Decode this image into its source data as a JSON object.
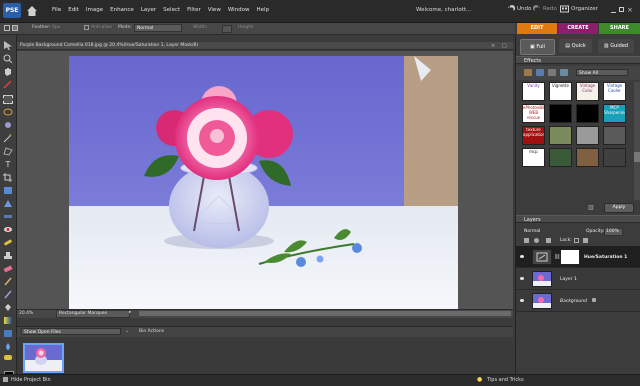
{
  "app": {
    "logo": "PSE"
  },
  "menu": [
    "File",
    "Edit",
    "Image",
    "Enhance",
    "Layer",
    "Select",
    "Filter",
    "View",
    "Window",
    "Help"
  ],
  "topbar": {
    "welcome": "Welcome, charlott...",
    "undo": "Undo",
    "redo": "Redo",
    "organizer": "Organizer"
  },
  "options": {
    "feather_label": "Feather:",
    "feather_value": "0px",
    "antialias": "Anti-alias",
    "mode_label": "Mode:",
    "mode_value": "Normal",
    "width_label": "Width:",
    "height_label": "Height:"
  },
  "tabs": {
    "edit": "EDIT",
    "create": "CREATE",
    "share": "SHARE"
  },
  "subtabs": {
    "full": "Full",
    "quick": "Quick",
    "guided": "Guided"
  },
  "document": {
    "title": "Purple Background Camellia 018.jpg @ 20.4%(Hue/Saturation 1, Layer Mask/8)",
    "zoom": "20.4%",
    "status_tool": "Rectangular Marquee"
  },
  "project_bin": {
    "show_select": "Show Open Files",
    "bin_actions": "Bin Actions",
    "hide_label": "Hide Project Bin",
    "tips_label": "Tips and Tricks"
  },
  "effects": {
    "title": "Effects",
    "filter_select": "Show All",
    "thumbs": [
      {
        "label": "Vanity",
        "bg": "#ffffff",
        "fg": "#7a3aa0"
      },
      {
        "label": "Vignette",
        "bg": "#ffffff",
        "fg": "#222222"
      },
      {
        "label": "Vintage Color",
        "bg": "#f7f2e8",
        "fg": "#7a2f6a"
      },
      {
        "label": "Vintage Cooler",
        "bg": "#ffffff",
        "fg": "#1f4aa8"
      },
      {
        "label": "ePhotoeBible WEB rescue",
        "bg": "#ffffff",
        "fg": "#b01a1a"
      },
      {
        "label": "",
        "bg": "#000000",
        "fg": "#ffffff"
      },
      {
        "label": "",
        "bg": "#000000",
        "fg": "#ffffff"
      },
      {
        "label": "MCP Sharpening",
        "bg": "#1aa0b8",
        "fg": "#ffffff"
      },
      {
        "label": "texture application",
        "bg": "#a01010",
        "fg": "#ffffff"
      },
      {
        "label": "",
        "bg": "#7a8a5a",
        "fg": "#ffffff"
      },
      {
        "label": "",
        "bg": "#9a9a9a",
        "fg": "#ffffff"
      },
      {
        "label": "",
        "bg": "#5a5a5a",
        "fg": "#ffffff"
      },
      {
        "label": "mcp",
        "bg": "#ffffff",
        "fg": "#222222"
      },
      {
        "label": "",
        "bg": "#3a5a3a",
        "fg": "#ffffff"
      },
      {
        "label": "",
        "bg": "#806040",
        "fg": "#ffffff"
      },
      {
        "label": "",
        "bg": "#404040",
        "fg": "#ffffff"
      }
    ],
    "apply": "Apply"
  },
  "layers": {
    "title": "Layers",
    "blend_mode": "Normal",
    "opacity_label": "Opacity:",
    "opacity_value": "100%",
    "lock_label": "Lock:",
    "items": [
      {
        "name": "Hue/Saturation 1"
      },
      {
        "name": "Layer 1"
      },
      {
        "name": "Background"
      }
    ]
  },
  "colors": {
    "edit_tab": "#e07a10",
    "create_tab": "#8a1f6b",
    "share_tab": "#3e8a2a",
    "backdrop": "#6a6ad0",
    "flower_pink": "#ee3c8e"
  }
}
